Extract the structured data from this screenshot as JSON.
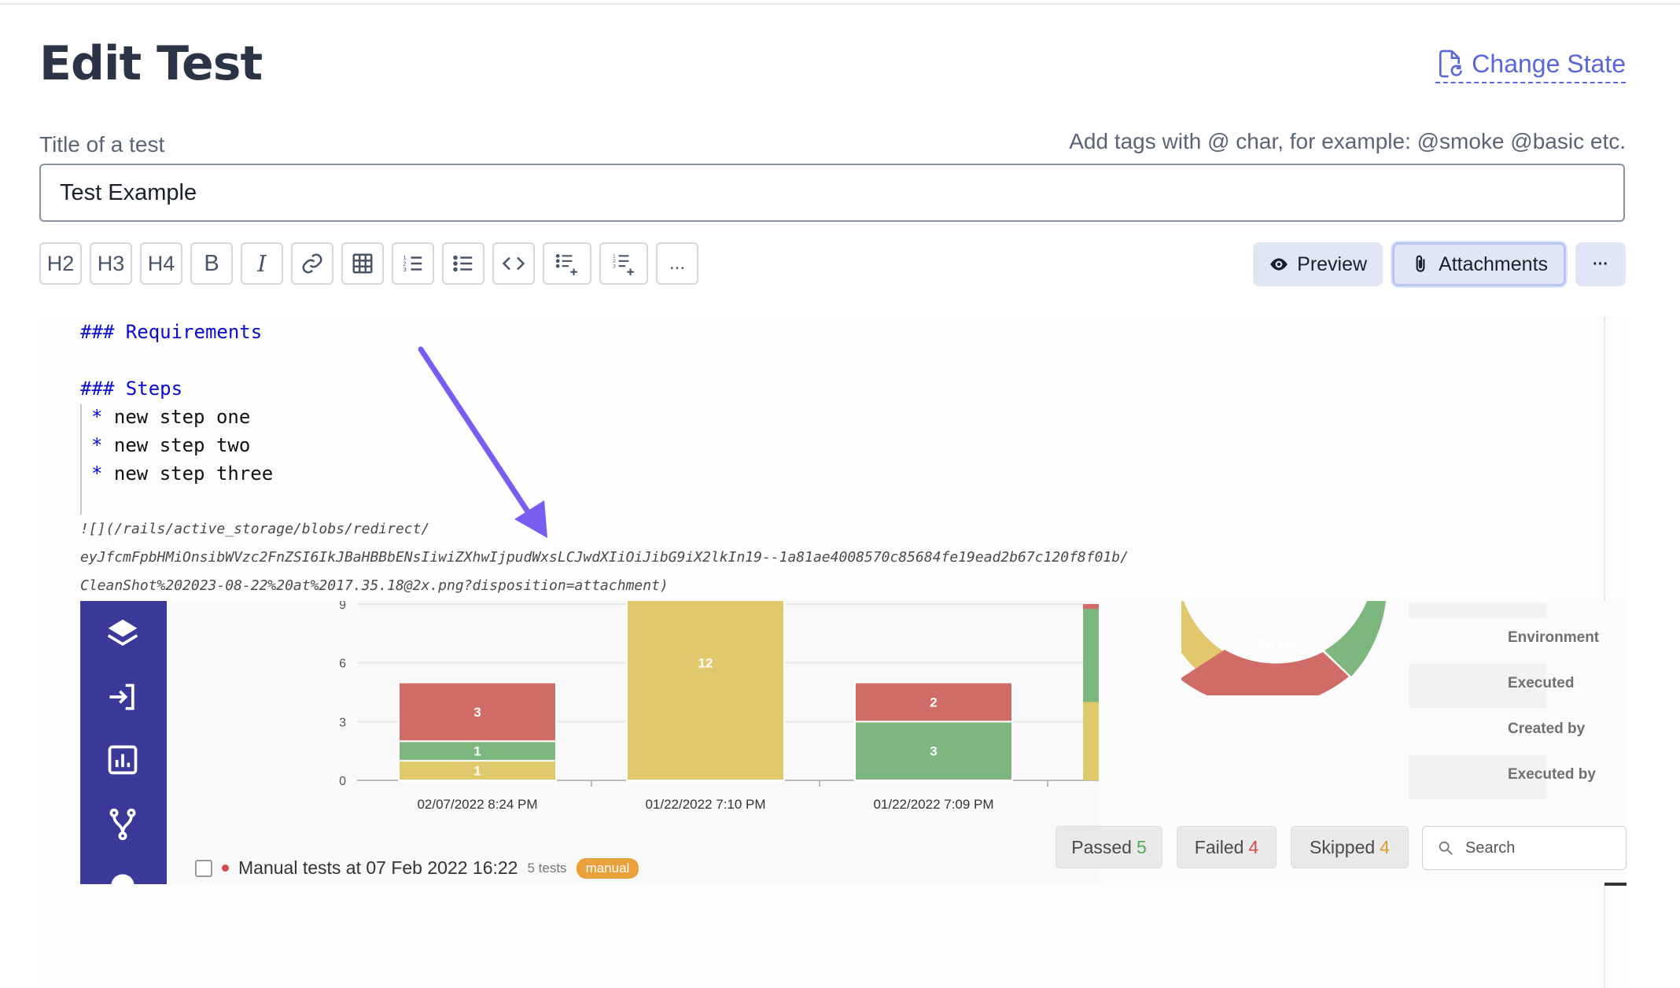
{
  "header": {
    "title": "Edit Test",
    "change_state": "Change State"
  },
  "form": {
    "title_label": "Title of a test",
    "tags_hint": "Add tags with @ char, for example: @smoke @basic etc.",
    "title_value": "Test Example"
  },
  "toolbar": {
    "buttons": [
      "H2",
      "H3",
      "H4",
      "B",
      "I",
      "link",
      "table",
      "ordered-list",
      "unordered-list",
      "code",
      "add-list",
      "add-numbered-list",
      "..."
    ],
    "h2": "H2",
    "h3": "H3",
    "h4": "H4",
    "bold": "B",
    "italic": "I",
    "more": "...",
    "preview": "Preview",
    "attachments": "Attachments",
    "overflow": "···"
  },
  "editor": {
    "line1": "### Requirements",
    "line2": "### Steps",
    "steps": [
      "new step one",
      "new step two",
      "new step three"
    ],
    "bullet": "*",
    "link_line1": "![](/rails/active_storage/blobs/redirect/",
    "link_line2": "eyJfcmFpbHMiOnsibWVzc2FnZSI6IkJBaHBBbENsIiwiZXhwIjpudWxsLCJwdXIiOiJibG9iX2lkIn19--1a81ae4008570c85684fe19ead2b67c120f8f01b/",
    "link_line3": "CleanShot%202023-08-22%20at%2017.35.18@2x.png?disposition=attachment)"
  },
  "embedded_screenshot": {
    "meta_rows": [
      "Environment",
      "Executed",
      "Created by",
      "Executed by"
    ],
    "donut_label": "30.8%",
    "status_buttons": [
      {
        "label": "Passed",
        "count": "5",
        "color": "#4caf50"
      },
      {
        "label": "Failed",
        "count": "4",
        "color": "#d14b4b"
      },
      {
        "label": "Skipped",
        "count": "4",
        "color": "#e09a2b"
      }
    ],
    "search_placeholder": "Search",
    "manual_run": {
      "title": "Manual tests at 07 Feb 2022 16:22",
      "count": "5 tests",
      "tag": "manual"
    }
  },
  "colors": {
    "accent": "#5a67d8",
    "heading_markdown": "#0a0ad0",
    "sidebar": "#3a3898",
    "bar_failed": "#d06b66",
    "bar_passed": "#7db77e",
    "bar_skipped": "#e2c86d",
    "arrow": "#7a5cf0"
  },
  "chart_data": {
    "type": "bar",
    "stacked": true,
    "categories": [
      "02/07/2022 8:24 PM",
      "01/22/2022 7:10 PM",
      "01/22/2022 7:09 PM"
    ],
    "series": [
      {
        "values": [
          1,
          12,
          0
        ],
        "color": "#e2c86d"
      },
      {
        "values": [
          1,
          0,
          3
        ],
        "color": "#7db77e"
      },
      {
        "values": [
          3,
          0,
          2
        ],
        "color": "#d06b66"
      }
    ],
    "yticks": [
      0,
      3,
      6,
      9
    ],
    "ylim": [
      0,
      9
    ],
    "data_labels": true
  }
}
